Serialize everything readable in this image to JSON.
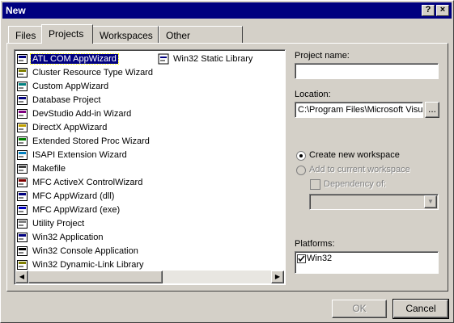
{
  "window": {
    "title": "New",
    "help_label": "?",
    "close_label": "×"
  },
  "tabs": [
    {
      "label": "Files"
    },
    {
      "label": "Projects"
    },
    {
      "label": "Workspaces"
    },
    {
      "label": "Other Documents"
    }
  ],
  "projects": {
    "selected": "ATL COM AppWizard",
    "items_col1": [
      "ATL COM AppWizard",
      "Cluster Resource Type Wizard",
      "Custom AppWizard",
      "Database Project",
      "DevStudio Add-in Wizard",
      "DirectX AppWizard",
      "Extended Stored Proc Wizard",
      "ISAPI Extension Wizard",
      "Makefile",
      "MFC ActiveX ControlWizard",
      "MFC AppWizard (dll)",
      "MFC AppWizard (exe)",
      "Utility Project",
      "Win32 Application",
      "Win32 Console Application",
      "Win32 Dynamic-Link Library"
    ],
    "items_col2": [
      "Win32 Static Library"
    ]
  },
  "form": {
    "project_name_label": "Project name:",
    "project_name_value": "",
    "location_label": "Location:",
    "location_value": "C:\\Program Files\\Microsoft Visua",
    "browse_label": "...",
    "create_new_label": "Create new workspace",
    "add_current_label": "Add to current workspace",
    "dependency_label": "Dependency of:",
    "platforms_label": "Platforms:",
    "platform_item": "Win32"
  },
  "buttons": {
    "ok": "OK",
    "cancel": "Cancel"
  }
}
